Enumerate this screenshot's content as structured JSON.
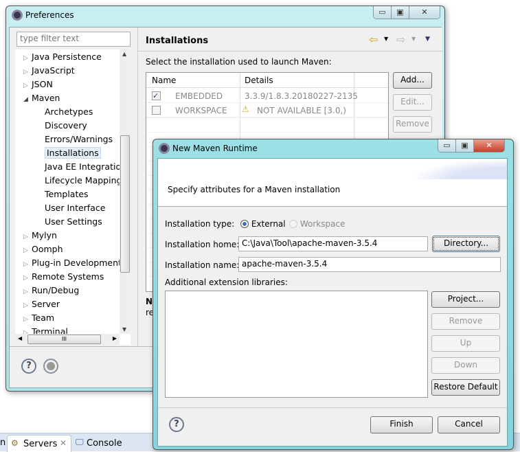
{
  "preferences": {
    "title": "Preferences",
    "filter_placeholder": "type filter text",
    "tree": [
      {
        "label": "Java Persistence",
        "level": 0,
        "state": "collapsed"
      },
      {
        "label": "JavaScript",
        "level": 0,
        "state": "collapsed"
      },
      {
        "label": "JSON",
        "level": 0,
        "state": "collapsed"
      },
      {
        "label": "Maven",
        "level": 0,
        "state": "expanded"
      },
      {
        "label": "Archetypes",
        "level": 1
      },
      {
        "label": "Discovery",
        "level": 1
      },
      {
        "label": "Errors/Warnings",
        "level": 1
      },
      {
        "label": "Installations",
        "level": 1,
        "selected": true
      },
      {
        "label": "Java EE Integration",
        "level": 1
      },
      {
        "label": "Lifecycle Mapping",
        "level": 1
      },
      {
        "label": "Templates",
        "level": 1
      },
      {
        "label": "User Interface",
        "level": 1
      },
      {
        "label": "User Settings",
        "level": 1
      },
      {
        "label": "Mylyn",
        "level": 0,
        "state": "collapsed"
      },
      {
        "label": "Oomph",
        "level": 0,
        "state": "collapsed"
      },
      {
        "label": "Plug-in Development",
        "level": 0,
        "state": "collapsed"
      },
      {
        "label": "Remote Systems",
        "level": 0,
        "state": "collapsed"
      },
      {
        "label": "Run/Debug",
        "level": 0,
        "state": "collapsed"
      },
      {
        "label": "Server",
        "level": 0,
        "state": "collapsed"
      },
      {
        "label": "Team",
        "level": 0,
        "state": "collapsed"
      },
      {
        "label": "Terminal",
        "level": 0,
        "state": "collapsed"
      }
    ],
    "page_title": "Installations",
    "description": "Select the installation used to launch Maven:",
    "columns": [
      "Name",
      "Details"
    ],
    "rows": [
      {
        "checked": true,
        "name": "EMBEDDED",
        "details": "3.3.9/1.8.3.20180227-2135",
        "warning": false
      },
      {
        "checked": false,
        "name": "WORKSPACE",
        "details": "NOT AVAILABLE [3.0,)",
        "warning": true
      }
    ],
    "buttons": {
      "add": "Add...",
      "edit": "Edit...",
      "remove": "Remove"
    },
    "partial_text": [
      "N",
      "re"
    ]
  },
  "dialog": {
    "title": "New Maven Runtime",
    "message": "Specify attributes for a Maven installation",
    "type_label": "Installation type:",
    "type_options": [
      "External",
      "Workspace"
    ],
    "type_selected": "External",
    "home_label": "Installation home:",
    "home_value": "C:\\Java\\Tool\\apache-maven-3.5.4",
    "directory_button": "Directory...",
    "name_label": "Installation name:",
    "name_value": "apache-maven-3.5.4",
    "ext_label": "Additional extension libraries:",
    "side_buttons": {
      "project": "Project...",
      "remove": "Remove",
      "up": "Up",
      "down": "Down",
      "restore": "Restore Default"
    },
    "finish": "Finish",
    "cancel": "Cancel"
  },
  "taskbar": {
    "partial": "n",
    "tabs": [
      "Servers",
      "Console"
    ]
  }
}
